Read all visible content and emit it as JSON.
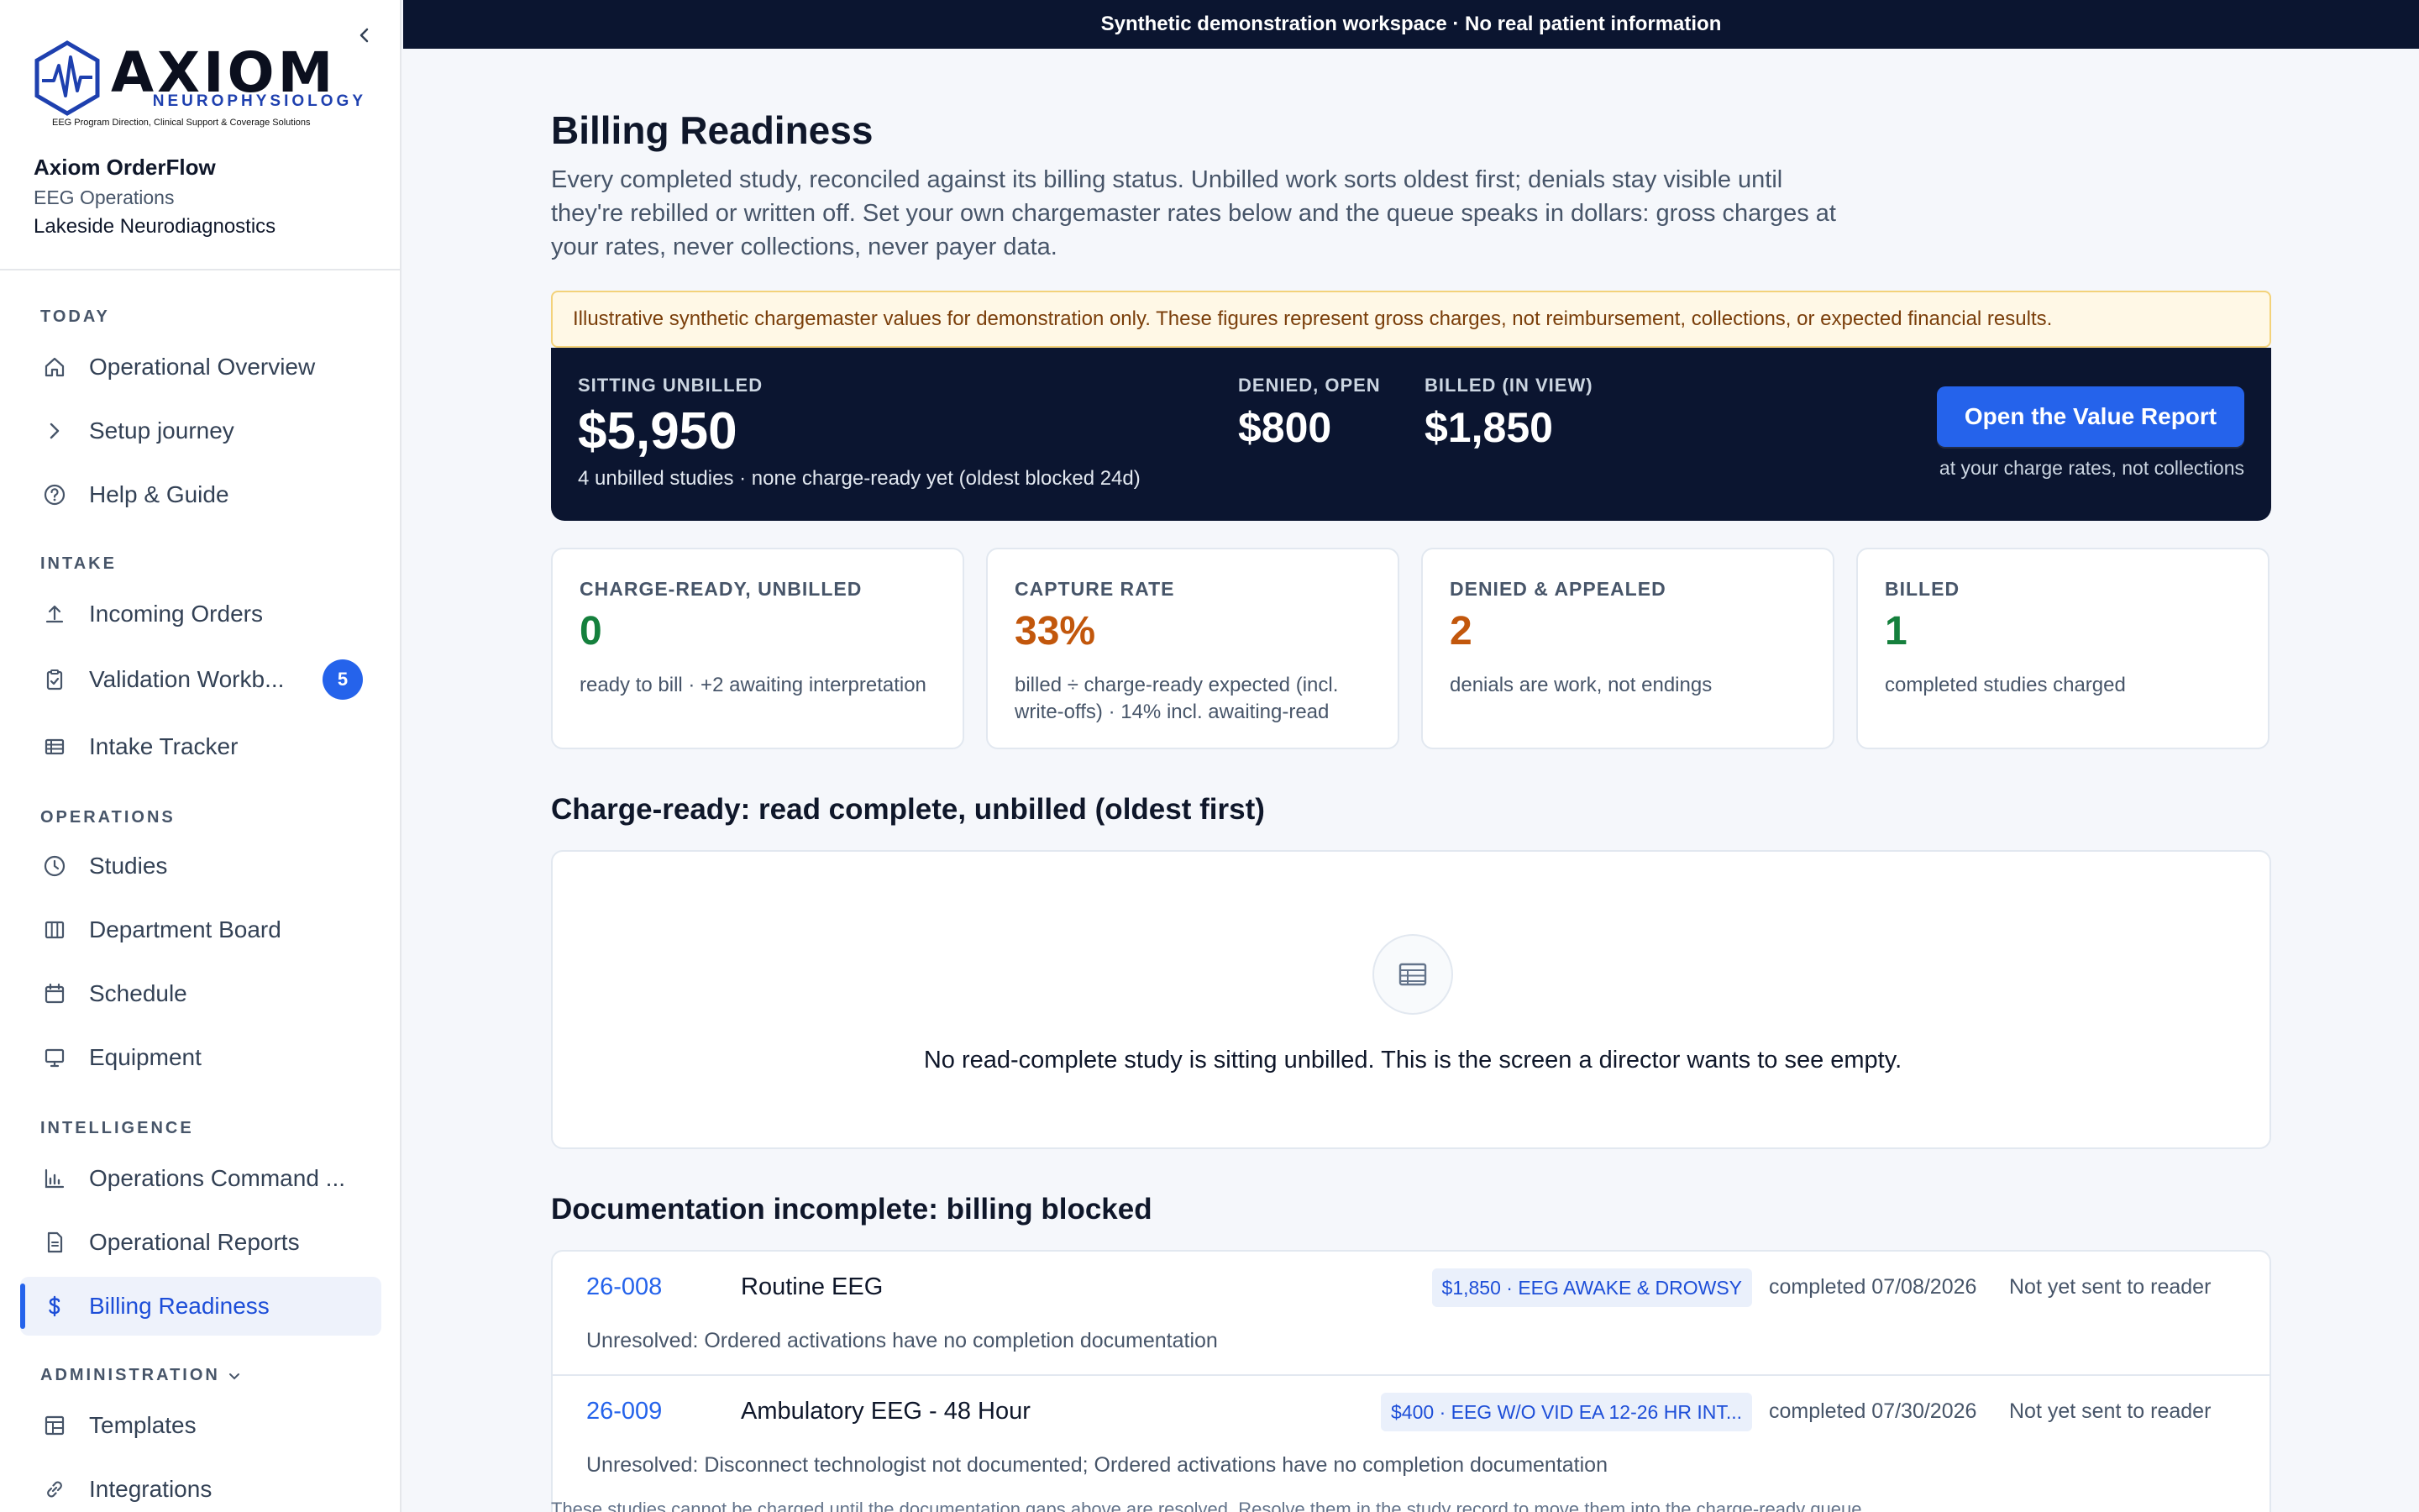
{
  "banner": "Synthetic demonstration workspace · No real patient information",
  "brand": {
    "word": "AXIOM",
    "sub": "NEUROPHYSIOLOGY",
    "tagline": "EEG Program Direction, Clinical Support & Coverage Solutions"
  },
  "org": {
    "app": "Axiom OrderFlow",
    "dept": "EEG Operations",
    "site": "Lakeside Neurodiagnostics"
  },
  "nav": {
    "today": "TODAY",
    "intake": "INTAKE",
    "operations": "OPERATIONS",
    "intelligence": "INTELLIGENCE",
    "administration": "ADMINISTRATION",
    "items": {
      "overview": "Operational Overview",
      "setup": "Setup journey",
      "help": "Help & Guide",
      "incoming": "Incoming Orders",
      "validation": "Validation Workb...",
      "validation_badge": "5",
      "tracker": "Intake Tracker",
      "studies": "Studies",
      "board": "Department Board",
      "schedule": "Schedule",
      "equipment": "Equipment",
      "command": "Operations Command ...",
      "reports": "Operational Reports",
      "billing": "Billing Readiness",
      "templates": "Templates",
      "integrations": "Integrations"
    }
  },
  "page": {
    "title": "Billing Readiness",
    "description": "Every completed study, reconciled against its billing status. Unbilled work sorts oldest first; denials stay visible until they're rebilled or written off. Set your own chargemaster rates below and the queue speaks in dollars: gross charges at your rates, never collections, never payer data.",
    "warning": "Illustrative synthetic chargemaster values for demonstration only. These figures represent gross charges, not reimbursement, collections, or expected financial results."
  },
  "hero": {
    "unbilled_label": "SITTING UNBILLED",
    "unbilled_value": "$5,950",
    "unbilled_sub": "4 unbilled studies · none charge-ready yet (oldest blocked 24d)",
    "denied_label": "DENIED, OPEN",
    "denied_value": "$800",
    "billed_label": "BILLED (IN VIEW)",
    "billed_value": "$1,850",
    "button": "Open the Value Report",
    "button_note": "at your charge rates, not collections"
  },
  "cards": [
    {
      "label": "CHARGE-READY, UNBILLED",
      "value": "0",
      "sub": "ready to bill · +2 awaiting interpretation",
      "color": "#15803d"
    },
    {
      "label": "CAPTURE RATE",
      "value": "33%",
      "sub": "billed ÷ charge-ready expected (incl. write-offs) · 14% incl. awaiting-read",
      "color": "#c2570c"
    },
    {
      "label": "DENIED & APPEALED",
      "value": "2",
      "sub": "denials are work, not endings",
      "color": "#c2570c"
    },
    {
      "label": "BILLED",
      "value": "1",
      "sub": "completed studies charged",
      "color": "#15803d"
    }
  ],
  "charge_ready": {
    "title": "Charge-ready: read complete, unbilled (oldest first)",
    "empty_text": "No read-complete study is sitting unbilled. This is the screen a director wants to see empty."
  },
  "doc_incomplete": {
    "title": "Documentation incomplete: billing blocked",
    "rows": [
      {
        "id": "26-008",
        "name": "Routine EEG",
        "tag": "$1,850 · EEG AWAKE & DROWSY",
        "date": "completed 07/08/2026",
        "status": "Not yet sent to reader",
        "note": "Unresolved: Ordered activations have no completion documentation"
      },
      {
        "id": "26-009",
        "name": "Ambulatory EEG - 48 Hour",
        "tag": "$400 · EEG W/O VID EA 12-26 HR INT...",
        "date": "completed 07/30/2026",
        "status": "Not yet sent to reader",
        "note": "Unresolved: Disconnect technologist not documented; Ordered activations have no completion documentation"
      }
    ],
    "footnote": "These studies cannot be charged until the documentation gaps above are resolved. Resolve them in the study record to move them into the charge-ready queue."
  }
}
